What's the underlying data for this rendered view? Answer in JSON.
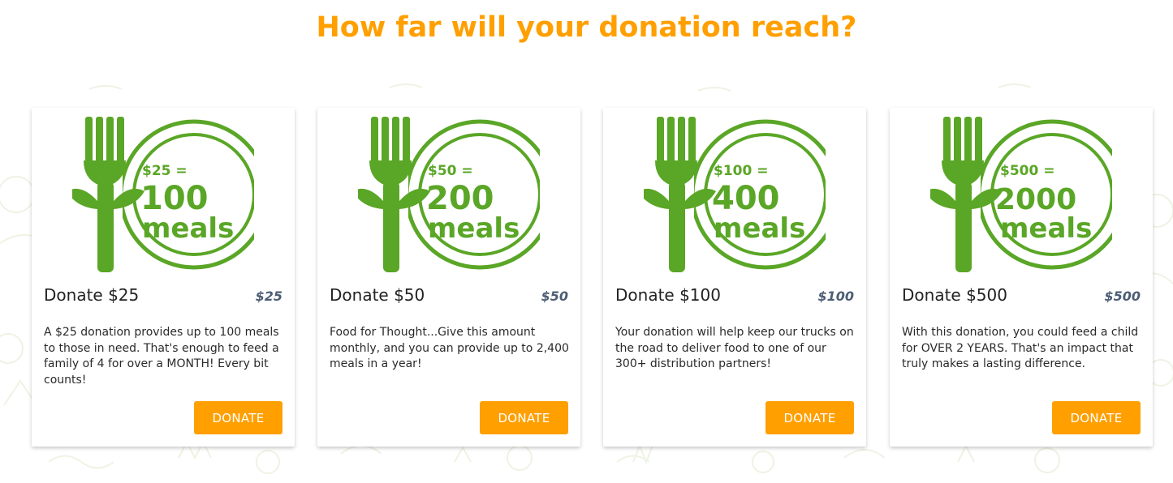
{
  "page": {
    "title": "How far will your donation reach?"
  },
  "colors": {
    "accent": "#ff9f00",
    "brand_green": "#5aa626",
    "price_text": "#4c5d73"
  },
  "cards": [
    {
      "image": {
        "amount": "$25 =",
        "number": "100",
        "unit": "meals",
        "icon": "fork-plate-icon"
      },
      "title": "Donate $25",
      "price": "$25",
      "description": "A $25 donation provides up to 100 meals to those in need. That's enough to feed a family of 4 for over a MONTH! Every bit counts!",
      "button": "DONATE"
    },
    {
      "image": {
        "amount": "$50 =",
        "number": "200",
        "unit": "meals",
        "icon": "fork-plate-icon"
      },
      "title": "Donate $50",
      "price": "$50",
      "description": "Food for Thought...Give this amount monthly, and you can provide up to 2,400 meals in a year!",
      "button": "DONATE"
    },
    {
      "image": {
        "amount": "$100 =",
        "number": "400",
        "unit": "meals",
        "icon": "fork-plate-icon"
      },
      "title": "Donate $100",
      "price": "$100",
      "description": "Your donation will help keep our trucks on the road to deliver food to one of our 300+ distribution partners!",
      "button": "DONATE"
    },
    {
      "image": {
        "amount": "$500 =",
        "number": "2000",
        "unit": "meals",
        "icon": "fork-plate-icon"
      },
      "title": "Donate $500",
      "price": "$500",
      "description": "With this donation, you could feed a child for OVER 2 YEARS. That's an impact that truly makes a lasting difference.",
      "button": "DONATE"
    }
  ]
}
